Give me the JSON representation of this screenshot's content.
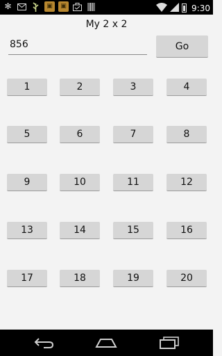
{
  "status_bar": {
    "time": "9:30",
    "icons": [
      "snowflake-icon",
      "mail-icon",
      "plant-icon",
      "game-icon",
      "game-icon",
      "briefcase-icon",
      "barcode-icon",
      "wifi-icon",
      "signal-icon",
      "battery-icon"
    ]
  },
  "app": {
    "title": "My 2 x 2"
  },
  "input": {
    "value": "856",
    "placeholder": ""
  },
  "go_button": {
    "label": "Go"
  },
  "number_buttons": [
    "1",
    "2",
    "3",
    "4",
    "5",
    "6",
    "7",
    "8",
    "9",
    "10",
    "11",
    "12",
    "13",
    "14",
    "15",
    "16",
    "17",
    "18",
    "19",
    "20"
  ],
  "nav": {
    "icons": [
      "back-icon",
      "home-icon",
      "recent-apps-icon"
    ]
  }
}
